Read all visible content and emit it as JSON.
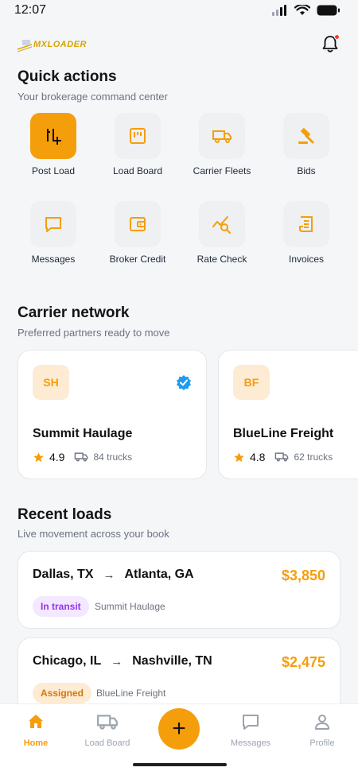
{
  "status": {
    "time": "12:07"
  },
  "header": {
    "logo_text": "MXLOADER"
  },
  "quick_actions": {
    "title": "Quick actions",
    "subtitle": "Your brokerage command center",
    "items": [
      {
        "label": "Post Load",
        "icon": "post-load-icon",
        "active": true
      },
      {
        "label": "Load Board",
        "icon": "load-board-icon"
      },
      {
        "label": "Carrier Fleets",
        "icon": "truck-icon"
      },
      {
        "label": "Bids",
        "icon": "gavel-icon"
      },
      {
        "label": "Messages",
        "icon": "chat-icon"
      },
      {
        "label": "Broker Credit",
        "icon": "wallet-icon"
      },
      {
        "label": "Rate Check",
        "icon": "rate-check-icon"
      },
      {
        "label": "Invoices",
        "icon": "invoice-icon"
      }
    ]
  },
  "carrier_network": {
    "title": "Carrier network",
    "subtitle": "Preferred partners ready to move",
    "carriers": [
      {
        "initials": "SH",
        "name": "Summit Haulage",
        "rating": "4.9",
        "trucks": "84 trucks",
        "verified": true
      },
      {
        "initials": "BF",
        "name": "BlueLine Freight",
        "rating": "4.8",
        "trucks": "62 trucks",
        "verified": false
      }
    ]
  },
  "recent_loads": {
    "title": "Recent loads",
    "subtitle": "Live movement across your book",
    "loads": [
      {
        "origin": "Dallas, TX",
        "arrow": "→",
        "destination": "Atlanta, GA",
        "price": "$3,850",
        "status": "In transit",
        "carrier": "Summit Haulage"
      },
      {
        "origin": "Chicago, IL",
        "arrow": "→",
        "destination": "Nashville, TN",
        "price": "$2,475",
        "status": "Assigned",
        "carrier": "BlueLine Freight"
      }
    ]
  },
  "bottom_nav": {
    "items": [
      {
        "label": "Home",
        "active": true
      },
      {
        "label": "Load Board"
      },
      {
        "label": "Messages"
      },
      {
        "label": "Profile"
      }
    ],
    "fab_symbol": "+"
  },
  "colors": {
    "accent": "#f59e0b",
    "background": "#f4f6f8",
    "transit_badge": "#9333ea",
    "verified": "#1d9bf0"
  }
}
